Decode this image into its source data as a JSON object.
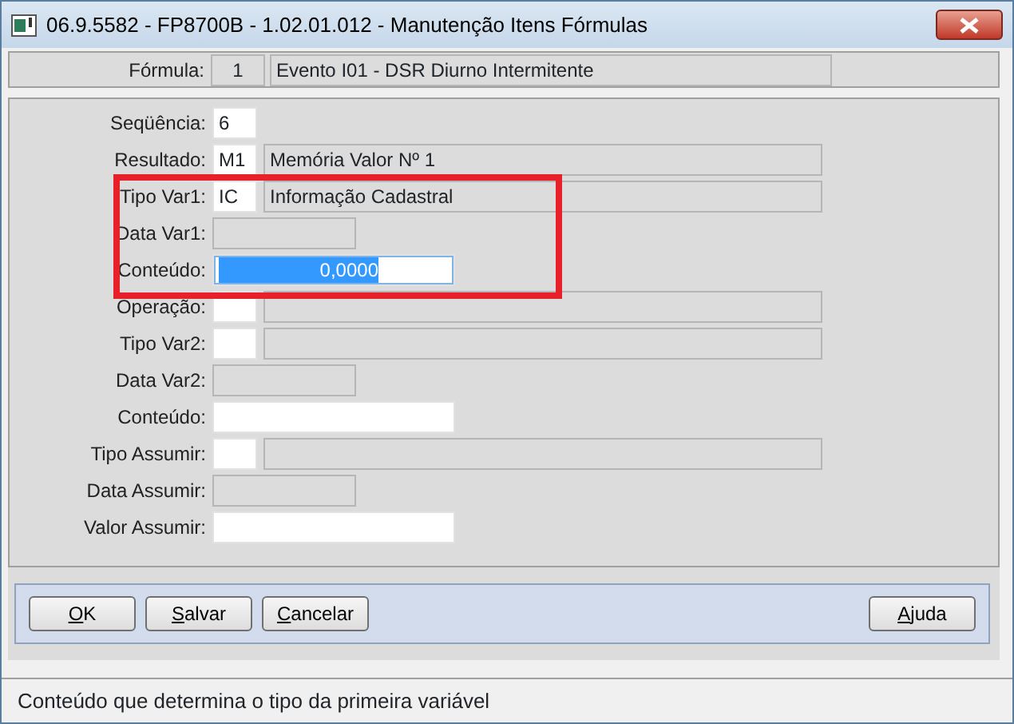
{
  "window": {
    "title": "06.9.5582 - FP8700B - 1.02.01.012 - Manutenção Itens Fórmulas"
  },
  "header": {
    "label": "Fórmula:",
    "code": "1",
    "description": "Evento I01 - DSR Diurno Intermitente"
  },
  "fields": [
    {
      "kind": "code",
      "label": "Seqüência:",
      "value": "6",
      "selected": false
    },
    {
      "kind": "code_desc",
      "label": "Resultado:",
      "value": "M1",
      "description": "Memória Valor Nº 1",
      "selected": false
    },
    {
      "kind": "code_desc",
      "label": "Tipo Var1:",
      "value": "IC",
      "description": "Informação Cadastral",
      "selected": false
    },
    {
      "kind": "date",
      "label": "Data Var1:",
      "selected": false
    },
    {
      "kind": "value",
      "label": "Conteúdo:",
      "value": "0,0000",
      "selected": true
    },
    {
      "kind": "code_desc",
      "label": "Operação:",
      "selected": false
    },
    {
      "kind": "code_desc",
      "label": "Tipo Var2:",
      "selected": false
    },
    {
      "kind": "date",
      "label": "Data Var2:",
      "selected": false
    },
    {
      "kind": "value",
      "label": "Conteúdo:",
      "selected": false
    },
    {
      "kind": "code_desc",
      "label": "Tipo Assumir:",
      "selected": false
    },
    {
      "kind": "date",
      "label": "Data Assumir:",
      "selected": false
    },
    {
      "kind": "value",
      "label": "Valor Assumir:",
      "selected": false
    }
  ],
  "buttons": [
    {
      "label": "OK"
    },
    {
      "label": "Salvar"
    },
    {
      "label": "Cancelar"
    },
    {
      "label": "Ajuda"
    }
  ],
  "status_bar": "Conteúdo que determina o tipo da primeira variável"
}
